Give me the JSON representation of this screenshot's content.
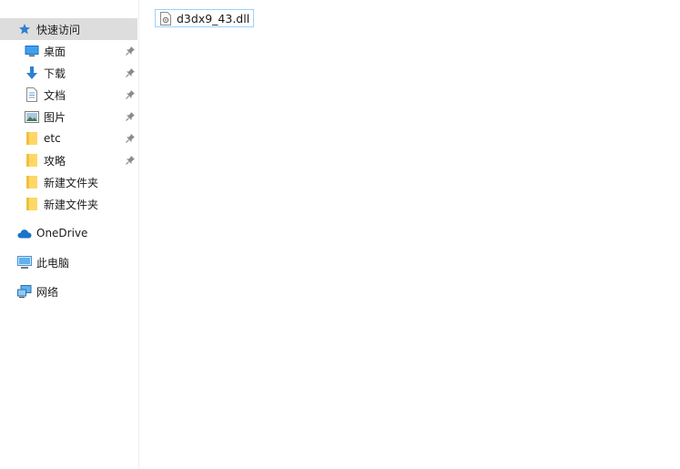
{
  "sidebar": {
    "quick_access": {
      "label": "快速访问",
      "icon": "star-icon"
    },
    "items": [
      {
        "label": "桌面",
        "icon": "desktop-icon",
        "pinned": true
      },
      {
        "label": "下载",
        "icon": "download-icon",
        "pinned": true
      },
      {
        "label": "文档",
        "icon": "document-icon",
        "pinned": true
      },
      {
        "label": "图片",
        "icon": "pictures-icon",
        "pinned": true
      },
      {
        "label": "etc",
        "icon": "folder-icon",
        "pinned": true
      },
      {
        "label": "攻略",
        "icon": "folder-icon",
        "pinned": true
      },
      {
        "label": "新建文件夹",
        "icon": "folder-icon",
        "pinned": false
      },
      {
        "label": "新建文件夹",
        "icon": "folder-icon",
        "pinned": false
      }
    ],
    "onedrive": {
      "label": "OneDrive",
      "icon": "cloud-icon"
    },
    "this_pc": {
      "label": "此电脑",
      "icon": "computer-icon"
    },
    "network": {
      "label": "网络",
      "icon": "network-icon"
    }
  },
  "content": {
    "files": [
      {
        "name": "d3dx9_43.dll",
        "icon": "dll-file-icon"
      }
    ]
  },
  "colors": {
    "selected_bg": "#dddddd",
    "file_border": "#99d1ff",
    "folder": "#ffd766",
    "onedrive_blue": "#1a73c8"
  }
}
